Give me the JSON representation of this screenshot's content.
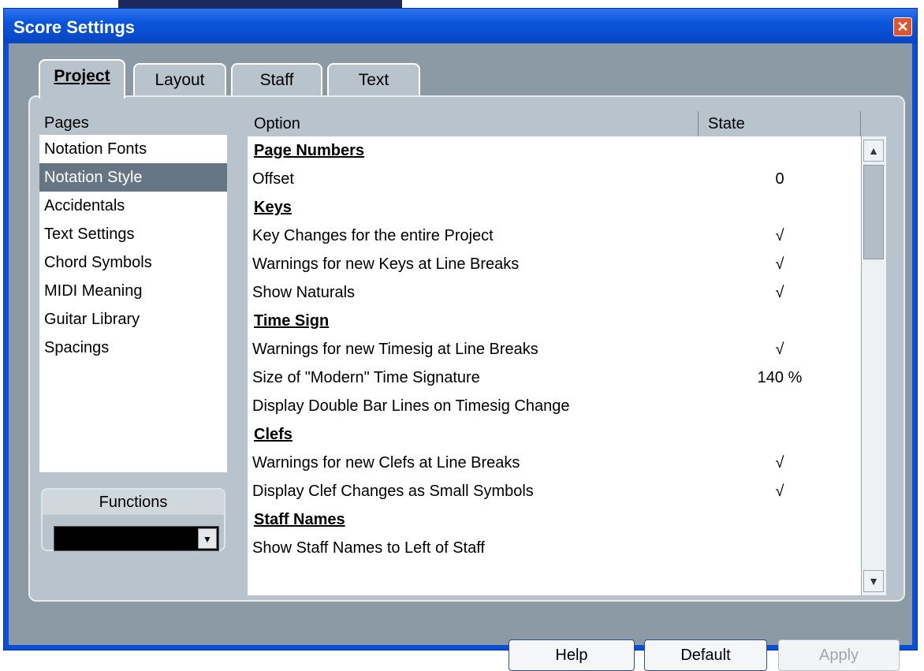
{
  "window": {
    "title": "Score Settings",
    "close_icon": "close-icon"
  },
  "tabs": [
    {
      "label": "Project",
      "active": true
    },
    {
      "label": "Layout",
      "active": false
    },
    {
      "label": "Staff",
      "active": false
    },
    {
      "label": "Text",
      "active": false
    }
  ],
  "pages": {
    "header": "Pages",
    "items": [
      "Notation Fonts",
      "Notation Style",
      "Accidentals",
      "Text Settings",
      "Chord Symbols",
      "MIDI Meaning",
      "Guitar Library",
      "Spacings"
    ],
    "selected": "Notation Style"
  },
  "functions": {
    "label": "Functions",
    "value": ""
  },
  "grid": {
    "col_option": "Option",
    "col_state": "State",
    "rows": [
      {
        "option": "Page Numbers",
        "state": "",
        "section": true
      },
      {
        "option": "Offset",
        "state": "0",
        "section": false
      },
      {
        "option": "Keys",
        "state": "",
        "section": true
      },
      {
        "option": "Key Changes for the entire Project",
        "state": "√",
        "section": false
      },
      {
        "option": "Warnings for new Keys at Line Breaks",
        "state": "√",
        "section": false
      },
      {
        "option": "Show Naturals",
        "state": "√",
        "section": false
      },
      {
        "option": "Time Sign",
        "state": "",
        "section": true
      },
      {
        "option": "Warnings for new Timesig at Line Breaks",
        "state": "√",
        "section": false
      },
      {
        "option": "Size of \"Modern\" Time Signature",
        "state": "140 %",
        "section": false
      },
      {
        "option": "Display Double Bar Lines on Timesig Change",
        "state": "",
        "section": false
      },
      {
        "option": "Clefs",
        "state": "",
        "section": true
      },
      {
        "option": "Warnings for new Clefs at Line Breaks",
        "state": "√",
        "section": false
      },
      {
        "option": "Display Clef Changes as Small Symbols",
        "state": "√",
        "section": false
      },
      {
        "option": "Staff Names",
        "state": "",
        "section": true
      },
      {
        "option": "Show Staff Names to Left of Staff",
        "state": "",
        "section": false
      }
    ]
  },
  "buttons": {
    "help": "Help",
    "default": "Default",
    "apply": "Apply"
  }
}
